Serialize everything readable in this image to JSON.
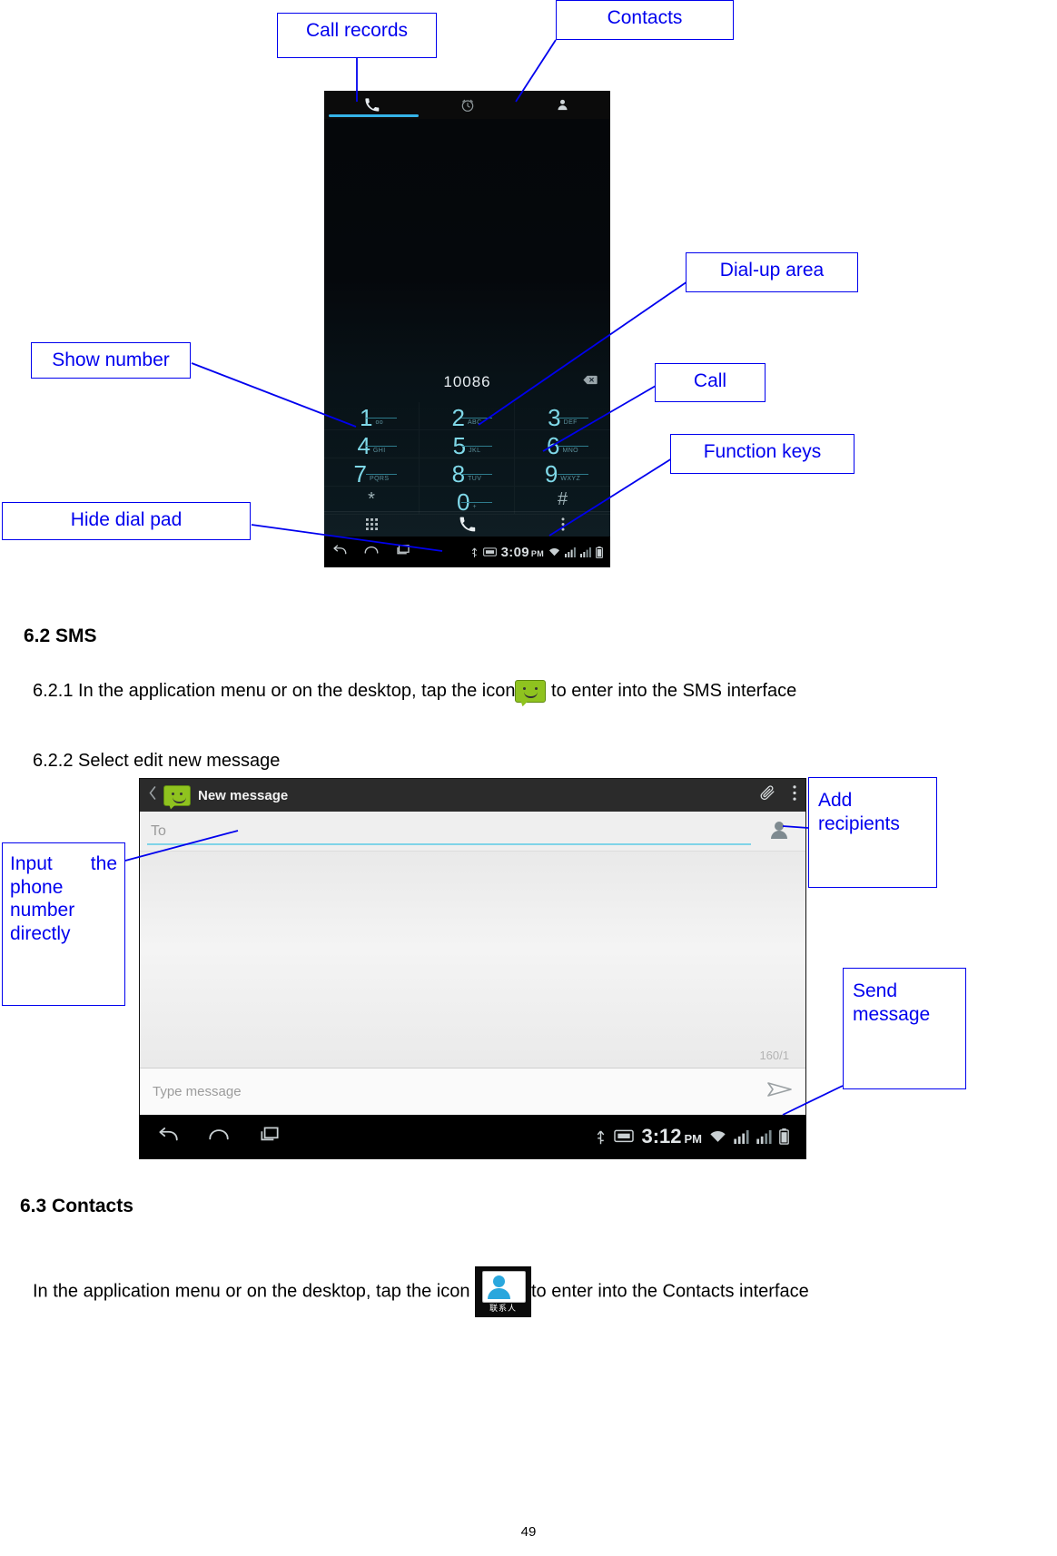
{
  "callouts": {
    "call_records": "Call records",
    "contacts": "Contacts",
    "dial_up_area": "Dial-up area",
    "show_number": "Show number",
    "call": "Call",
    "function_keys": "Function keys",
    "hide_dial_pad": "Hide dial pad",
    "add_recipients": "Add\nrecipients",
    "input_phone": "Input the phone number directly",
    "send_message": "Send\nmessage"
  },
  "dialer": {
    "dialed_number": "10086",
    "tabs": [
      {
        "name": "phone-tab",
        "icon": "phone-icon",
        "active": true
      },
      {
        "name": "call-log-tab",
        "icon": "clock-icon",
        "active": false
      },
      {
        "name": "contacts-tab",
        "icon": "person-icon",
        "active": false
      }
    ],
    "keys": [
      {
        "digit": "1",
        "letters": "oo"
      },
      {
        "digit": "2",
        "letters": "ABC"
      },
      {
        "digit": "3",
        "letters": "DEF"
      },
      {
        "digit": "4",
        "letters": "GHI"
      },
      {
        "digit": "5",
        "letters": "JKL"
      },
      {
        "digit": "6",
        "letters": "MNO"
      },
      {
        "digit": "7",
        "letters": "PQRS"
      },
      {
        "digit": "8",
        "letters": "TUV"
      },
      {
        "digit": "9",
        "letters": "WXYZ"
      },
      {
        "digit": "*",
        "letters": ""
      },
      {
        "digit": "0",
        "letters": "+"
      },
      {
        "digit": "#",
        "letters": ""
      }
    ],
    "status_time": "3:09",
    "status_ampm": "PM"
  },
  "sections": {
    "sms_heading": "6.2 SMS",
    "sms_621": "6.2.1 In the application menu or on the desktop, tap the icon",
    "sms_621_tail": "to enter into the SMS interface",
    "sms_622": "6.2.2 Select edit new message",
    "contacts_heading": "6.3 Contacts",
    "contacts_para_head": "In the application menu or on the desktop, tap the icon",
    "contacts_para_tail": "to enter into the Contacts interface",
    "contacts_icon_label": "联系人"
  },
  "sms_screen": {
    "title": "New message",
    "to_placeholder": "To",
    "counter": "160/1",
    "type_placeholder": "Type message",
    "status_time": "3:12",
    "status_ampm": "PM"
  },
  "footer": {
    "page_number": "49"
  },
  "colors": {
    "annotation": "#0000ee",
    "accent": "#35b3e8",
    "sms_green": "#8fc31f"
  }
}
